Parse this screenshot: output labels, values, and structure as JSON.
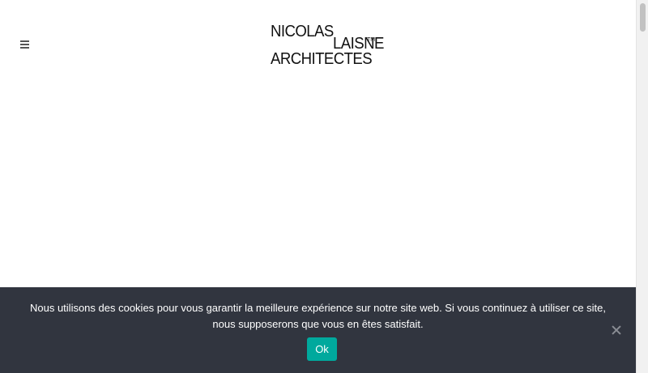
{
  "header": {
    "logo": {
      "line1": "NICOLAS",
      "line2": "LAISNE",
      "trademark": "TM",
      "line3": "ARCHITECTES"
    },
    "menu_icon": "hamburger-icon"
  },
  "cookie_banner": {
    "message": "Nous utilisons des cookies pour vous garantir la meilleure expérience sur notre site web. Si vous continuez à utiliser ce site, nous supposerons que vous en êtes satisfait.",
    "accept_label": "Ok",
    "close_icon": "close-icon",
    "background_color": "#31353f",
    "button_color": "#00a99d"
  }
}
